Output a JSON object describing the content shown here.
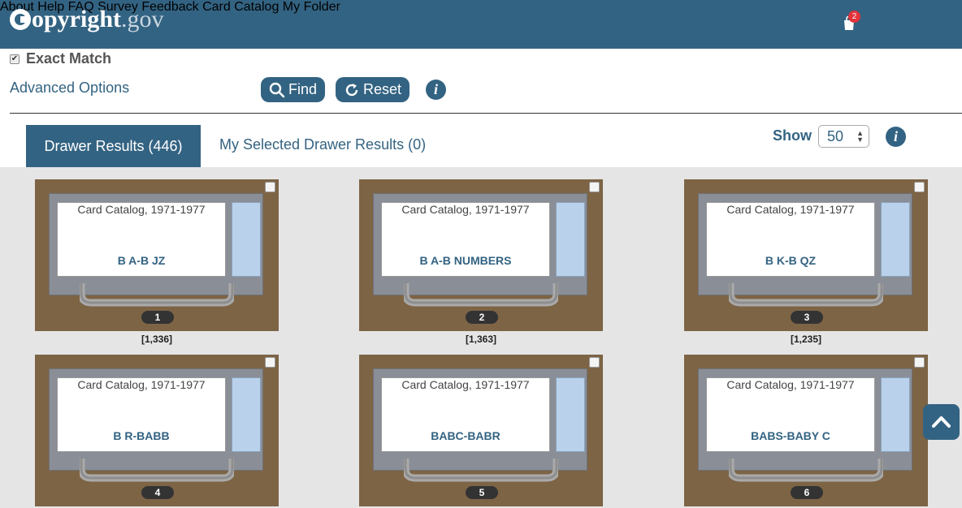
{
  "header": {
    "logo_word": "opyright",
    "logo_tld": ".gov",
    "nav": [
      "About",
      "Help",
      "FAQ",
      "Survey",
      "Feedback",
      "Card Catalog",
      "My Folder"
    ],
    "cart_count": "2"
  },
  "controls": {
    "exact_match_label": "Exact Match",
    "exact_match_checked": true,
    "advanced_options": "Advanced Options",
    "find_label": "Find",
    "reset_label": "Reset",
    "info_glyph": "i"
  },
  "tabs": {
    "active": "Drawer Results (446)",
    "inactive": "My Selected Drawer Results (0)"
  },
  "show": {
    "label": "Show",
    "value": "50"
  },
  "drawers": [
    {
      "catalog": "Card Catalog, 1971-1977",
      "range": "B A-B JZ",
      "number": "1",
      "count": "[1,336]"
    },
    {
      "catalog": "Card Catalog, 1971-1977",
      "range": "B A-B NUMBERS",
      "number": "2",
      "count": "[1,363]"
    },
    {
      "catalog": "Card Catalog, 1971-1977",
      "range": "B K-B QZ",
      "number": "3",
      "count": "[1,235]"
    },
    {
      "catalog": "Card Catalog, 1971-1977",
      "range": "B R-BABB",
      "number": "4",
      "count": ""
    },
    {
      "catalog": "Card Catalog, 1971-1977",
      "range": "BABC-BABR",
      "number": "5",
      "count": ""
    },
    {
      "catalog": "Card Catalog, 1971-1977",
      "range": "BABS-BABY C",
      "number": "6",
      "count": ""
    }
  ],
  "icons": {
    "search": "search-icon",
    "reset": "refresh-icon",
    "info": "info-icon",
    "cart": "cart-icon",
    "back_to_top": "chevron-up-icon"
  },
  "colors": {
    "brand": "#336382",
    "drawer_wood": "#7d6445",
    "background": "#e5e5e5",
    "badge": "#e3323a"
  }
}
